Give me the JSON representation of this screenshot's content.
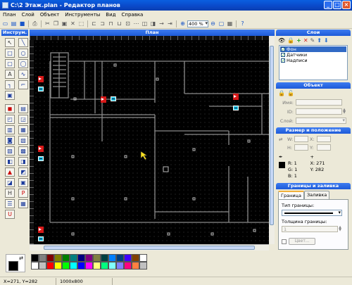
{
  "window": {
    "title": "C:\\2 Этаж.plan - Редактор планов"
  },
  "menu": [
    "План",
    "Слой",
    "Объект",
    "Инструменты",
    "Вид",
    "Справка"
  ],
  "toolbar": {
    "zoom": "400 %"
  },
  "tools_panel": {
    "title": "Инструм."
  },
  "plan_panel": {
    "title": "План"
  },
  "layers": {
    "title": "Слои",
    "items": [
      {
        "label": "Фон",
        "checked": true,
        "selected": true
      },
      {
        "label": "Датчики",
        "checked": true,
        "selected": false
      },
      {
        "label": "Надписи",
        "checked": true,
        "selected": false
      }
    ]
  },
  "object": {
    "title": "Объект",
    "name_label": "Имя:",
    "id_label": "ID:",
    "layer_label": "Слой:"
  },
  "size_position": {
    "title": "Размер и положение",
    "w_label": "W:",
    "h_label": "H:",
    "x_label": "X:",
    "y_label": "Y:"
  },
  "color_info": {
    "r": "R: 1",
    "g": "G: 1",
    "b": "B: 1",
    "x": "X: 271",
    "y": "Y: 282"
  },
  "border_fill": {
    "title": "Границы и заливка",
    "tab_border": "Граница",
    "tab_fill": "Заливка",
    "border_type_label": "Тип границы:",
    "border_thickness_label": "Толщина границы:",
    "thickness_value": "1",
    "color_button": "Цвет..."
  },
  "palette": {
    "colors": [
      "#000000",
      "#808080",
      "#800000",
      "#808000",
      "#008000",
      "#008080",
      "#000080",
      "#800080",
      "#808040",
      "#004040",
      "#0080ff",
      "#004080",
      "#4000ff",
      "#804000",
      "#ffffff",
      "#ffffff",
      "#c0c0c0",
      "#ff0000",
      "#ffff00",
      "#00ff00",
      "#00ffff",
      "#0000ff",
      "#ff00ff",
      "#ffff80",
      "#00ff80",
      "#80ffff",
      "#8080ff",
      "#ff0080",
      "#ff8040",
      "#c0c0c0"
    ]
  },
  "status": {
    "coords": "X=271, Y=282",
    "size": "1000x800"
  }
}
